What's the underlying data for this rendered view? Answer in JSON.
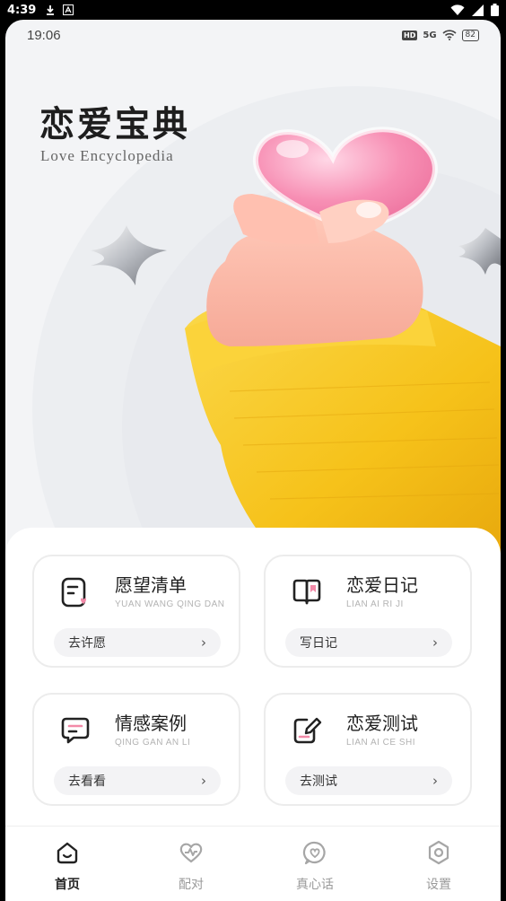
{
  "system_bar": {
    "time": "4:39",
    "left_icons": [
      "download-icon",
      "app-a-icon"
    ],
    "right_icons": [
      "wifi-icon",
      "signal-icon",
      "battery-icon"
    ]
  },
  "inner_status": {
    "time": "19:06",
    "hd": "HD",
    "network": "5G",
    "battery": "82"
  },
  "hero": {
    "title": "恋爱宝典",
    "subtitle": "Love Encyclopedia"
  },
  "features": [
    {
      "title": "愿望清单",
      "subtitle": "YUAN WANG QING DAN",
      "button": "去许愿",
      "icon": "wishlist-icon"
    },
    {
      "title": "恋爱日记",
      "subtitle": "LIAN AI RI JI",
      "button": "写日记",
      "icon": "diary-icon"
    },
    {
      "title": "情感案例",
      "subtitle": "QING GAN AN LI",
      "button": "去看看",
      "icon": "case-message-icon"
    },
    {
      "title": "恋爱测试",
      "subtitle": "LIAN AI CE SHI",
      "button": "去测试",
      "icon": "test-edit-icon"
    }
  ],
  "tabs": [
    {
      "label": "首页",
      "icon": "home-icon",
      "active": true
    },
    {
      "label": "配对",
      "icon": "heartbeat-icon",
      "active": false
    },
    {
      "label": "真心话",
      "icon": "heart-bubble-icon",
      "active": false
    },
    {
      "label": "设置",
      "icon": "settings-icon",
      "active": false
    }
  ],
  "colors": {
    "background": "#f3f4f6",
    "sleeve_yellow": "#f7c51f",
    "heart_pink": "#f58fb2",
    "active_tab": "#222222",
    "inactive_tab": "#9a9a9a"
  }
}
